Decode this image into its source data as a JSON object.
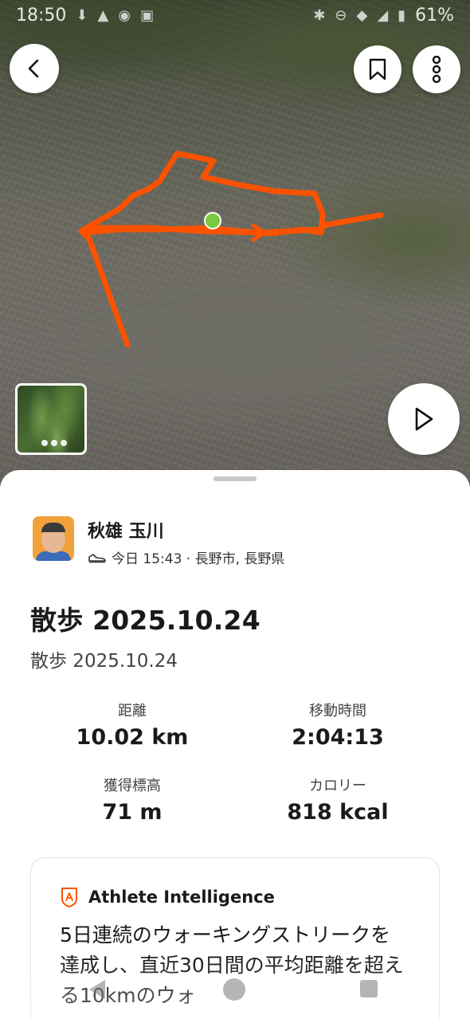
{
  "status_bar": {
    "time": "18:50",
    "battery": "61%",
    "icons": [
      "notification-icon",
      "alert-icon",
      "sync-icon",
      "gallery-icon",
      "bluetooth-icon",
      "dnd-icon",
      "wifi-icon",
      "signal-icon",
      "battery-icon"
    ]
  },
  "map": {
    "route_color": "#fc5200",
    "start_marker_color": "#7ac943",
    "buttons": [
      "back-icon",
      "bookmark-icon",
      "more-vertical-icon",
      "play-icon"
    ]
  },
  "athlete": {
    "name": "秋雄 玉川",
    "meta": "今日 15:43 · 長野市, 長野県",
    "activity_icon": "shoe-icon"
  },
  "activity": {
    "title": "散歩 2025.10.24",
    "subtitle": "散歩 2025.10.24"
  },
  "stats": [
    {
      "label": "距離",
      "value": "10.02 km"
    },
    {
      "label": "移動時間",
      "value": "2:04:13"
    },
    {
      "label": "獲得標高",
      "value": "71 m"
    },
    {
      "label": "カロリー",
      "value": "818 kcal"
    }
  ],
  "athlete_intelligence": {
    "title": "Athlete Intelligence",
    "body": "5日連続のウォーキングストリークを達成し、直近30日間の平均距離を超える10kmのウォ"
  },
  "colors": {
    "accent": "#fc5200",
    "text": "#1a1a1a"
  }
}
